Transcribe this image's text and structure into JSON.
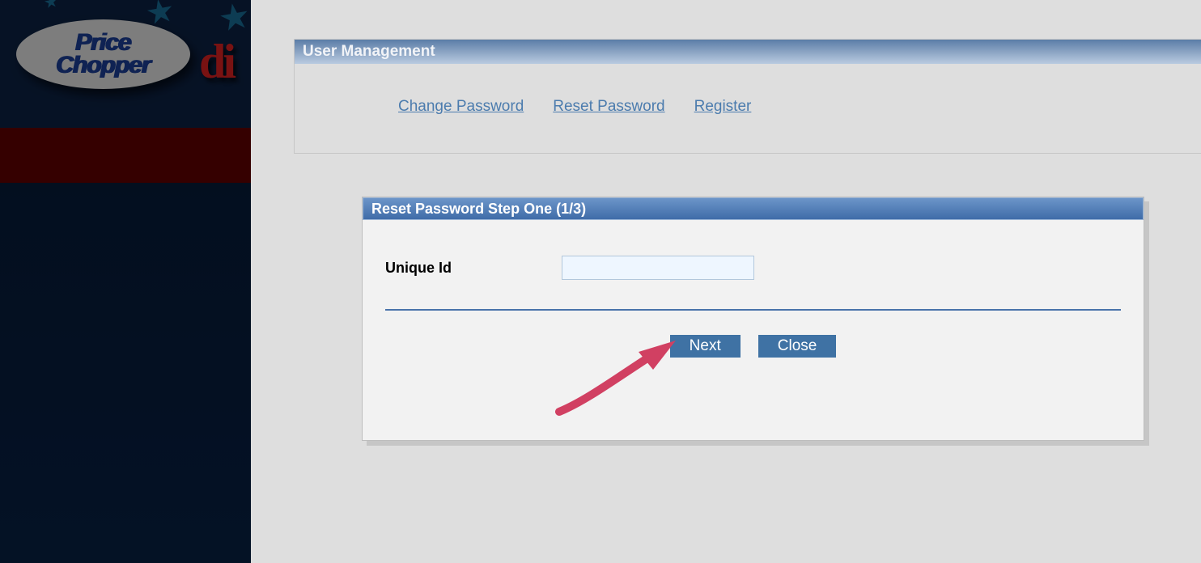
{
  "sidebar": {
    "logo_line1": "Price",
    "logo_line2": "Chopper",
    "logo_fragment": "di"
  },
  "user_management": {
    "title": "User Management",
    "links": {
      "change_password": "Change Password",
      "reset_password": "Reset Password",
      "register": "Register"
    }
  },
  "reset_panel": {
    "title": "Reset Password Step One (1/3)",
    "fields": {
      "unique_id": {
        "label": "Unique Id",
        "value": ""
      }
    },
    "buttons": {
      "next": "Next",
      "close": "Close"
    }
  },
  "annotation": {
    "arrow_color": "#d14062",
    "points_to": "next-button"
  }
}
